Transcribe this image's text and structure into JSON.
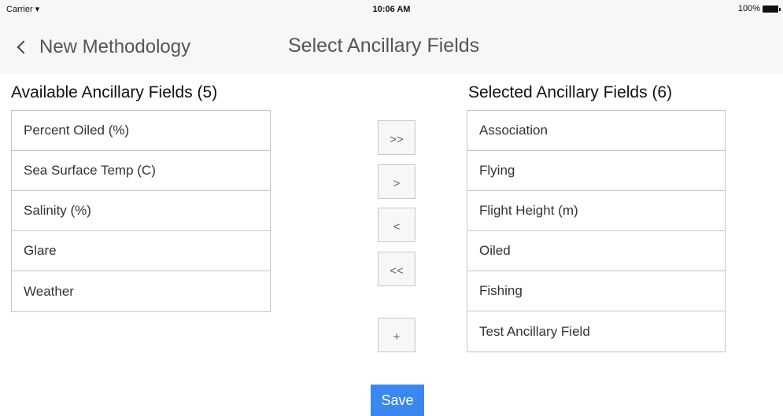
{
  "status_bar": {
    "carrier": "Carrier",
    "wifi_icon": "wifi-icon",
    "time": "10:06 AM",
    "battery_percent": "100%",
    "battery_icon": "battery-icon"
  },
  "nav": {
    "back_label": "New Methodology",
    "back_icon": "chevron-left-icon",
    "title": "Select Ancillary Fields"
  },
  "available": {
    "heading": "Available Ancillary Fields (5)",
    "items": [
      "Percent Oiled (%)",
      "Sea Surface Temp (C)",
      "Salinity (%)",
      "Glare",
      "Weather"
    ]
  },
  "selected": {
    "heading": "Selected Ancillary Fields (6)",
    "items": [
      "Association",
      "Flying",
      "Flight Height (m)",
      "Oiled",
      "Fishing",
      "Test Ancillary Field"
    ]
  },
  "controls": {
    "move_all_right": ">>",
    "move_right": ">",
    "move_left": "<",
    "move_all_left": "<<",
    "add": "+"
  },
  "save_label": "Save",
  "colors": {
    "accent": "#3b87f0",
    "nav_background": "#f7f7f7",
    "border": "#c4c4c4"
  }
}
